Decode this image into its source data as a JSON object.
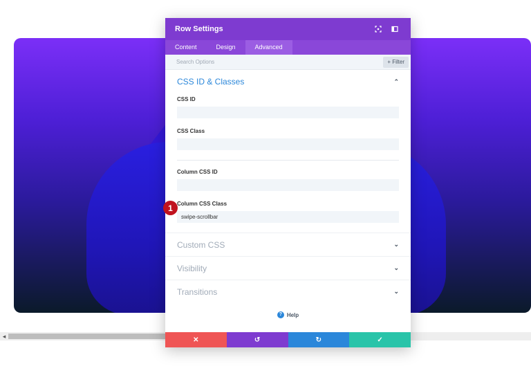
{
  "modal": {
    "title": "Row Settings",
    "tabs": [
      "Content",
      "Design",
      "Advanced"
    ],
    "active_tab": "Advanced",
    "search_placeholder": "Search Options",
    "filter_label": "+ Filter",
    "open_section": {
      "title": "CSS ID & Classes",
      "fields": [
        {
          "label": "CSS ID",
          "value": ""
        },
        {
          "label": "CSS Class",
          "value": ""
        },
        {
          "label": "Column CSS ID",
          "value": ""
        },
        {
          "label": "Column CSS Class",
          "value": "swipe-scrollbar"
        }
      ]
    },
    "collapsed_sections": [
      "Custom CSS",
      "Visibility",
      "Transitions"
    ],
    "help_label": "Help",
    "footer_buttons": [
      {
        "name": "discard",
        "symbol": "✕",
        "color": "#ef5555"
      },
      {
        "name": "undo",
        "symbol": "↺",
        "color": "#7e3bd0"
      },
      {
        "name": "redo",
        "symbol": "↻",
        "color": "#2b87da"
      },
      {
        "name": "save",
        "symbol": "✓",
        "color": "#29c4a9"
      }
    ]
  },
  "badge": "1",
  "colors": {
    "header": "#7e3bd0",
    "accent": "#2b87da"
  }
}
